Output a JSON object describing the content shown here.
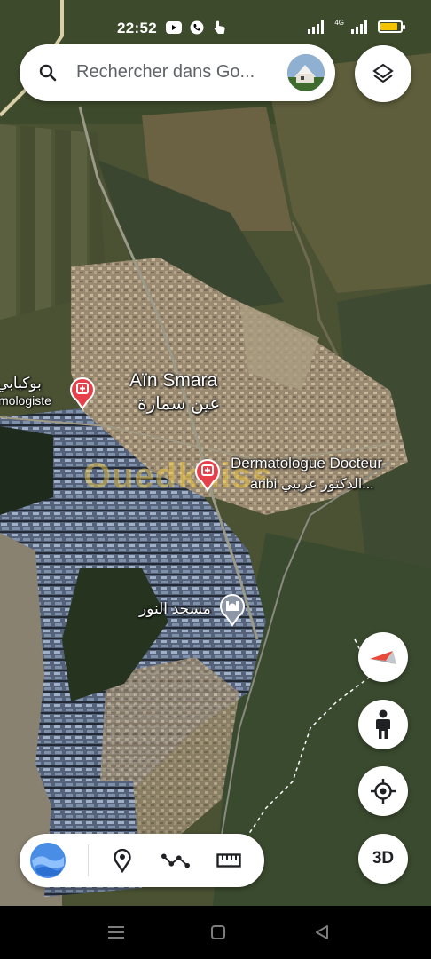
{
  "status_bar": {
    "time": "22:52",
    "network_label": "4G",
    "battery_level": 0.85,
    "battery_color": "#f4c400"
  },
  "search": {
    "placeholder": "Rechercher dans Go..."
  },
  "map_labels": {
    "city_name": "Aïn Smara",
    "city_name_ar": "عين سمارة",
    "place_left_ar": "بوكبابي",
    "place_left_fr": "mologiste",
    "dermatologue_name": "Dermatologue Docteur",
    "dermatologue_sub": "aribi الدكتور عريبي...",
    "mosque_name": "مسجد النور"
  },
  "watermark_text": "Ouedkniss",
  "buttons": {
    "threed_label": "3D"
  },
  "icons": {
    "search": "search-icon",
    "layers": "layers-icon",
    "compass": "compass-icon",
    "pegman": "pegman-icon",
    "location": "my-location-icon",
    "earth": "earth-icon",
    "pin": "place-pin-icon",
    "path": "path-icon",
    "ruler": "ruler-icon"
  },
  "colors": {
    "pin_red": "#e8404a",
    "pin_grey": "#8e97a6",
    "compass_red": "#e8493a"
  }
}
